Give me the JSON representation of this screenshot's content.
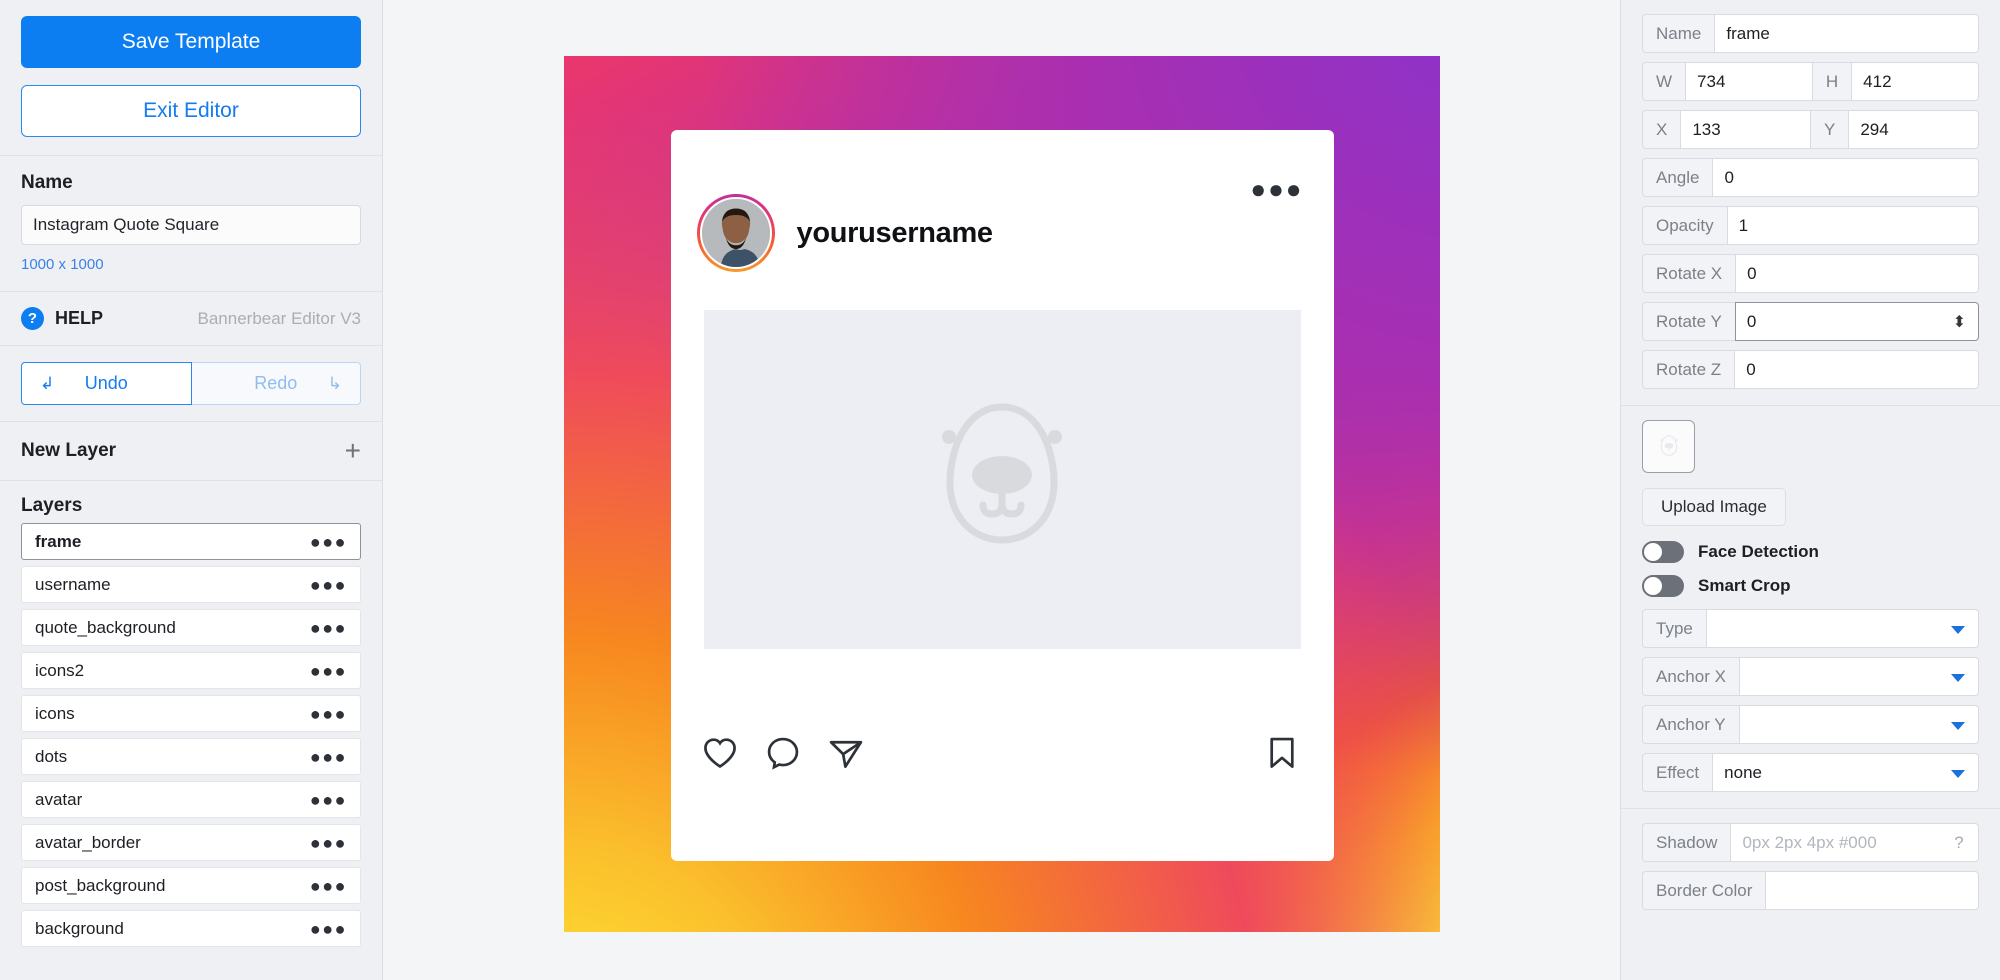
{
  "sidebar": {
    "save_button": "Save Template",
    "exit_button": "Exit Editor",
    "name_label": "Name",
    "name_value": "Instagram Quote Square",
    "dimensions": "1000 x 1000",
    "help_label": "HELP",
    "help_icon": "question-circle-icon",
    "version": "Bannerbear Editor V3",
    "undo_label": "Undo",
    "undo_icon": "undo-arrow-icon",
    "redo_label": "Redo",
    "redo_icon": "redo-arrow-icon",
    "new_layer_label": "New Layer",
    "add_icon": "plus-icon",
    "layers_label": "Layers",
    "layers": [
      {
        "name": "frame",
        "selected": true
      },
      {
        "name": "username",
        "selected": false
      },
      {
        "name": "quote_background",
        "selected": false
      },
      {
        "name": "icons2",
        "selected": false
      },
      {
        "name": "icons",
        "selected": false
      },
      {
        "name": "dots",
        "selected": false
      },
      {
        "name": "avatar",
        "selected": false
      },
      {
        "name": "avatar_border",
        "selected": false
      },
      {
        "name": "post_background",
        "selected": false
      },
      {
        "name": "background",
        "selected": false
      }
    ],
    "layer_menu_icon": "ellipsis-icon"
  },
  "canvas": {
    "post": {
      "username": "yourusername",
      "more_icon": "ellipsis-icon",
      "placeholder_icon": "bear-logo-placeholder",
      "actions": {
        "like_icon": "heart-icon",
        "comment_icon": "comment-bubble-icon",
        "share_icon": "paper-plane-icon",
        "save_icon": "bookmark-icon"
      }
    },
    "background_gradient": {
      "yellow": "#fbe72e",
      "orange": "#f7871f",
      "pink": "#e8366f",
      "purple": "#8a33cc"
    }
  },
  "properties": {
    "name_label": "Name",
    "name_value": "frame",
    "w_label": "W",
    "w_value": "734",
    "h_label": "H",
    "h_value": "412",
    "x_label": "X",
    "x_value": "133",
    "y_label": "Y",
    "y_value": "294",
    "angle_label": "Angle",
    "angle_value": "0",
    "opacity_label": "Opacity",
    "opacity_value": "1",
    "rotate_x_label": "Rotate X",
    "rotate_x_value": "0",
    "rotate_y_label": "Rotate Y",
    "rotate_y_value": "0",
    "rotate_z_label": "Rotate Z",
    "rotate_z_value": "0",
    "thumbnail_icon": "bear-logo-placeholder",
    "upload_button": "Upload Image",
    "face_detection_label": "Face Detection",
    "smart_crop_label": "Smart Crop",
    "type_label": "Type",
    "type_value": "",
    "anchor_x_label": "Anchor X",
    "anchor_x_value": "",
    "anchor_y_label": "Anchor Y",
    "anchor_y_value": "",
    "effect_label": "Effect",
    "effect_value": "none",
    "shadow_label": "Shadow",
    "shadow_placeholder": "0px 2px 4px #000",
    "shadow_help_icon": "question-circle-icon",
    "border_color_label": "Border Color",
    "border_color_value": "",
    "dropdown_icon": "chevron-down-icon",
    "spinner_icon": "stepper-arrows-icon"
  }
}
